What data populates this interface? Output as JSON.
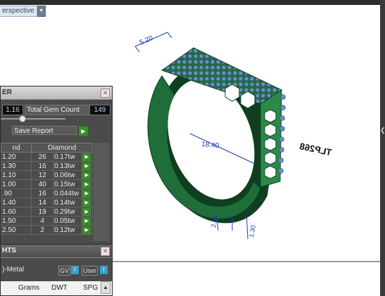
{
  "viewport": {
    "view_mode": "erspective",
    "dimensions": {
      "top_width": "5.20",
      "inner_diameter": "18.40",
      "shank_width": "2.50",
      "shank_thickness": "1.30"
    },
    "engraving": "TLP268"
  },
  "gem_panel": {
    "title": "ER",
    "close_icon": "close-icon",
    "stat_value": "1.16",
    "total_gem_label": "Total Gem Count",
    "total_gem_value": "149",
    "save_report_label": "Save Report",
    "table": {
      "headers": [
        "nd",
        "Diamond"
      ],
      "rows": [
        [
          "1.20",
          "26",
          "0.17tw"
        ],
        [
          "1.30",
          "16",
          "0.13tw"
        ],
        [
          "1.10",
          "12",
          "0.06tw"
        ],
        [
          "1.00",
          "40",
          "0.15tw"
        ],
        [
          ".90",
          "16",
          "0.044tw"
        ],
        [
          "1.40",
          "14",
          "0.14tw"
        ],
        [
          "1.60",
          "19",
          "0.29tw"
        ],
        [
          "1.50",
          "4",
          "0.05tw"
        ],
        [
          "2.50",
          "2",
          "0.12tw"
        ]
      ]
    }
  },
  "weights_panel": {
    "title": "HTS",
    "metal_label": ")-Metal",
    "gv_label": "GV",
    "user_label": "User",
    "toggle_value": "I",
    "columns": [
      "Grams",
      "DWT",
      "SPG"
    ]
  },
  "colors": {
    "ring_metal": "#1f6e3a",
    "ring_dark": "#0f3f1e",
    "gem": "#6a8fbf",
    "dimension_line": "#1a3fb5",
    "panel_bg": "#4b4b4b",
    "go_button": "#3b8c2a"
  }
}
